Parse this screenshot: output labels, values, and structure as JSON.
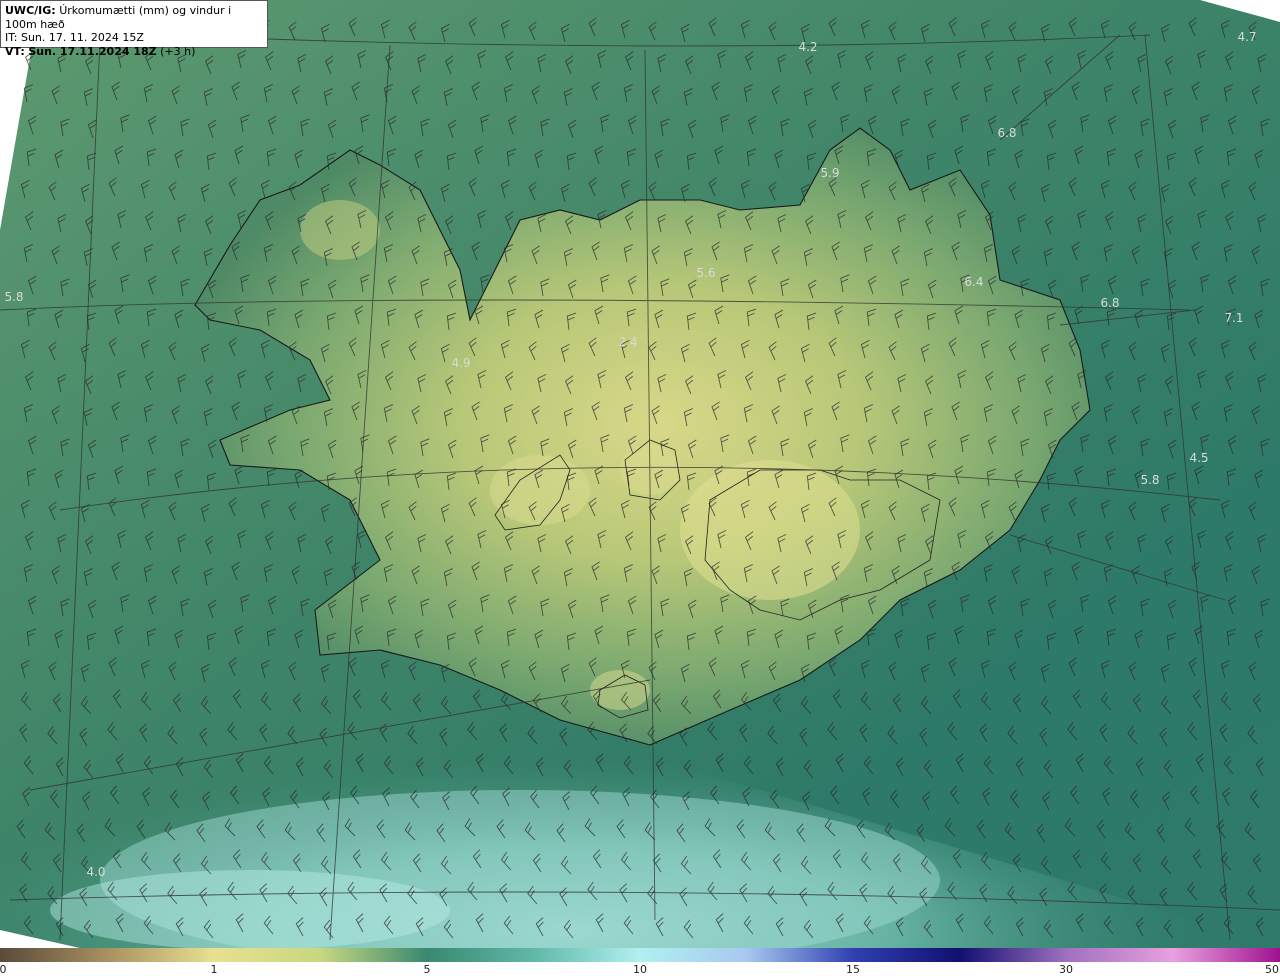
{
  "header": {
    "model": "UWC/IG:",
    "title": "Úrkomumætti (mm) og vindur i 100m hæð",
    "init_prefix": "IT:",
    "init_time": "Sun. 17. 11. 2024 15Z",
    "valid_prefix": "VT:",
    "valid_time": "Sun. 17.11.2024 18Z",
    "lead": "(+3 h)"
  },
  "stations": [
    {
      "value": "4.2"
    },
    {
      "value": "4.7"
    },
    {
      "value": "6.8"
    },
    {
      "value": "5.9"
    },
    {
      "value": "5.8"
    },
    {
      "value": "5.6"
    },
    {
      "value": "6.4"
    },
    {
      "value": "6.8"
    },
    {
      "value": "7.1"
    },
    {
      "value": "2.4"
    },
    {
      "value": "4.9"
    },
    {
      "value": "4.5"
    },
    {
      "value": "5.8"
    },
    {
      "value": "4.0"
    }
  ],
  "colorbar": {
    "ticks": [
      "0",
      "1",
      "5",
      "10",
      "15",
      "30",
      "50"
    ],
    "colors": [
      "#5a4a3a",
      "#a89060",
      "#e8e090",
      "#c8d880",
      "#3a8870",
      "#60b8a8",
      "#b0f0f0",
      "#a8c8f0",
      "#3040b0",
      "#101070",
      "#a070c0",
      "#e8a0e0",
      "#a01090"
    ]
  }
}
